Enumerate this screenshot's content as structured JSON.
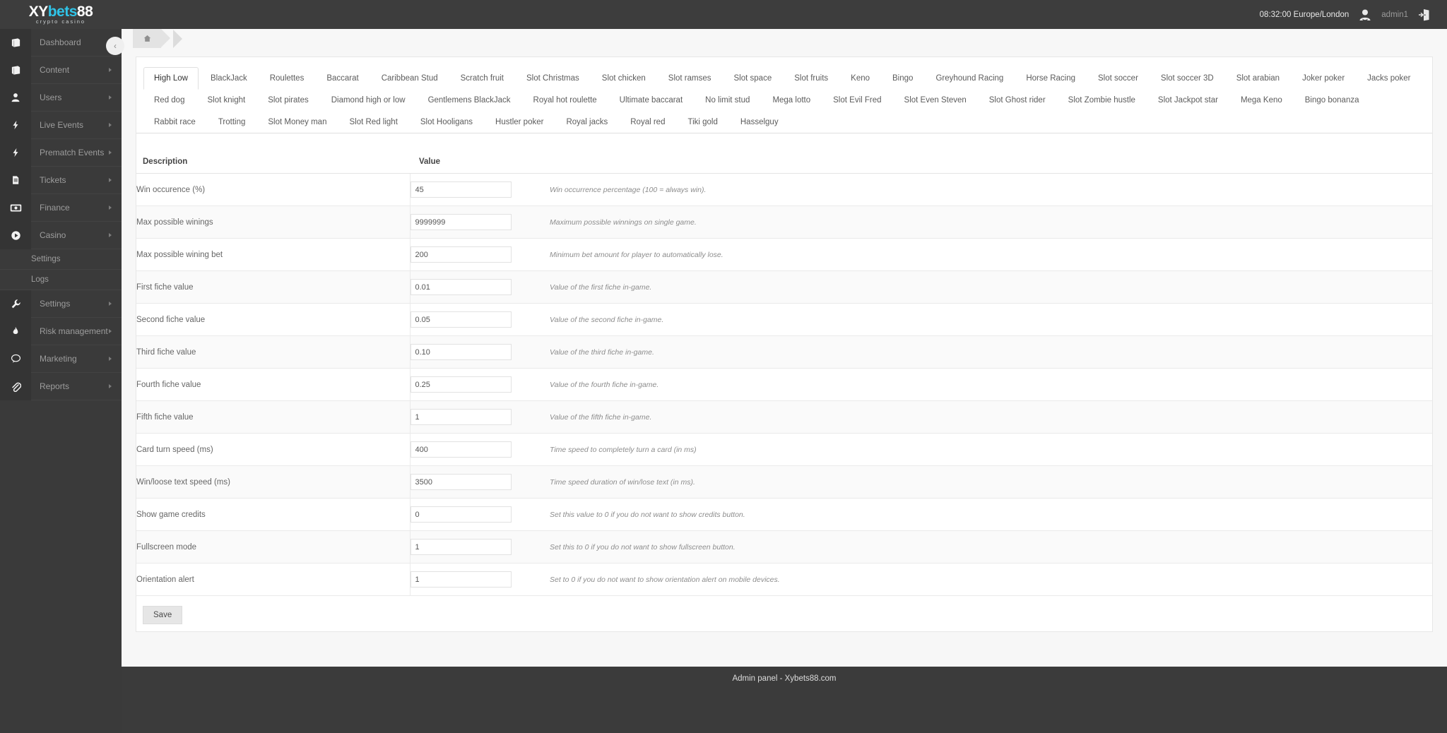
{
  "brand": {
    "name_part1": "XY",
    "name_part2": "bets",
    "name_part3": "88",
    "tagline": "crypto casino",
    "accent_color": "#2fc4e8"
  },
  "topbar": {
    "time": "08:32:00 Europe/London",
    "username": "admin1",
    "user_icon": "user-icon",
    "logout_icon": "logout-icon"
  },
  "sidebar": {
    "items": [
      {
        "label": "Dashboard",
        "icon": "book-icon",
        "has_arrow": true
      },
      {
        "label": "Content",
        "icon": "book-icon",
        "has_arrow": true
      },
      {
        "label": "Users",
        "icon": "user-icon",
        "has_arrow": true
      },
      {
        "label": "Live Events",
        "icon": "bolt-icon",
        "has_arrow": true
      },
      {
        "label": "Prematch Events",
        "icon": "bolt-icon",
        "has_arrow": true
      },
      {
        "label": "Tickets",
        "icon": "file-icon",
        "has_arrow": true
      },
      {
        "label": "Finance",
        "icon": "money-icon",
        "has_arrow": true
      },
      {
        "label": "Casino",
        "icon": "play-icon",
        "has_arrow": true
      },
      {
        "label": "Settings",
        "icon": "wrench-icon",
        "has_arrow": true
      },
      {
        "label": "Risk management",
        "icon": "flame-icon",
        "has_arrow": true
      },
      {
        "label": "Marketing",
        "icon": "chat-icon",
        "has_arrow": true
      },
      {
        "label": "Reports",
        "icon": "clip-icon",
        "has_arrow": true
      }
    ],
    "casino_submenu": [
      "Settings",
      "Logs"
    ],
    "collapse_icon": "chevron-left-icon"
  },
  "breadcrumb": {
    "home_icon": "home-icon"
  },
  "tabs": {
    "active": "High Low",
    "items": [
      "High Low",
      "BlackJack",
      "Roulettes",
      "Baccarat",
      "Caribbean Stud",
      "Scratch fruit",
      "Slot Christmas",
      "Slot chicken",
      "Slot ramses",
      "Slot space",
      "Slot fruits",
      "Keno",
      "Bingo",
      "Greyhound Racing",
      "Horse Racing",
      "Slot soccer",
      "Slot soccer 3D",
      "Slot arabian",
      "Joker poker",
      "Jacks poker",
      "Red dog",
      "Slot knight",
      "Slot pirates",
      "Diamond high or low",
      "Gentlemens BlackJack",
      "Royal hot roulette",
      "Ultimate baccarat",
      "No limit stud",
      "Mega lotto",
      "Slot Evil Fred",
      "Slot Even Steven",
      "Slot Ghost rider",
      "Slot Zombie hustle",
      "Slot Jackpot star",
      "Mega Keno",
      "Bingo bonanza",
      "Rabbit race",
      "Trotting",
      "Slot Money man",
      "Slot Red light",
      "Slot Hooligans",
      "Hustler poker",
      "Royal jacks",
      "Royal red",
      "Tiki gold",
      "Hasselguy"
    ]
  },
  "table": {
    "headers": {
      "description": "Description",
      "value": "Value"
    },
    "rows": [
      {
        "description": "Win occurence (%)",
        "value": "45",
        "help": "Win occurrence percentage (100 = always win)."
      },
      {
        "description": "Max possible winings",
        "value": "9999999",
        "help": "Maximum possible winnings on single game."
      },
      {
        "description": "Max possible wining bet",
        "value": "200",
        "help": "Minimum bet amount for player to automatically lose."
      },
      {
        "description": "First fiche value",
        "value": "0.01",
        "help": "Value of the first fiche in-game."
      },
      {
        "description": "Second fiche value",
        "value": "0.05",
        "help": "Value of the second fiche in-game."
      },
      {
        "description": "Third fiche value",
        "value": "0.10",
        "help": "Value of the third fiche in-game."
      },
      {
        "description": "Fourth fiche value",
        "value": "0.25",
        "help": "Value of the fourth fiche in-game."
      },
      {
        "description": "Fifth fiche value",
        "value": "1",
        "help": "Value of the fifth fiche in-game."
      },
      {
        "description": "Card turn speed (ms)",
        "value": "400",
        "help": "Time speed to completely turn a card (in ms)"
      },
      {
        "description": "Win/loose text speed (ms)",
        "value": "3500",
        "help": "Time speed duration of win/lose text (in ms)."
      },
      {
        "description": "Show game credits",
        "value": "0",
        "help": "Set this value to 0 if you do not want to show credits button."
      },
      {
        "description": "Fullscreen mode",
        "value": "1",
        "help": "Set this to 0 if you do not want to show fullscreen button."
      },
      {
        "description": "Orientation alert",
        "value": "1",
        "help": "Set to 0 if you do not want to show orientation alert on mobile devices."
      }
    ]
  },
  "actions": {
    "save_label": "Save"
  },
  "footer": {
    "text": "Admin panel - Xybets88.com"
  }
}
